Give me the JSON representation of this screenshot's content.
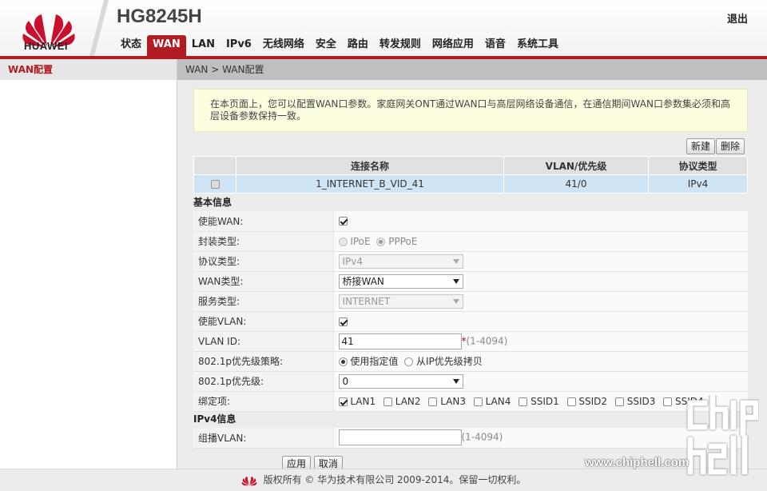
{
  "brand": {
    "logo_text": "HUAWEI",
    "model": "HG8245H",
    "accent_color": "#b11c22"
  },
  "header": {
    "logout_label": "退出"
  },
  "nav": [
    {
      "label": "状态",
      "active": false
    },
    {
      "label": "WAN",
      "active": true
    },
    {
      "label": "LAN",
      "active": false
    },
    {
      "label": "IPv6",
      "active": false
    },
    {
      "label": "无线网络",
      "active": false
    },
    {
      "label": "安全",
      "active": false
    },
    {
      "label": "路由",
      "active": false
    },
    {
      "label": "转发规则",
      "active": false
    },
    {
      "label": "网络应用",
      "active": false
    },
    {
      "label": "语音",
      "active": false
    },
    {
      "label": "系统工具",
      "active": false
    }
  ],
  "sidebar": {
    "items": [
      {
        "label": "WAN配置",
        "selected": true
      }
    ]
  },
  "breadcrumb": "WAN > WAN配置",
  "notice": "在本页面上，您可以配置WAN口参数。家庭网关ONT通过WAN口与高层网络设备通信，在通信期间WAN口参数集必须和高层设备参数保持一致。",
  "toolbar": {
    "new_label": "新建",
    "delete_label": "删除"
  },
  "wan_table": {
    "headers": [
      "",
      "连接名称",
      "VLAN/优先级",
      "协议类型"
    ],
    "rows": [
      {
        "checked": false,
        "name": "1_INTERNET_B_VID_41",
        "vlan_priority": "41/0",
        "protocol": "IPv4"
      }
    ]
  },
  "basic": {
    "title": "基本信息",
    "enable_wan": {
      "label": "使能WAN:",
      "checked": true
    },
    "encap": {
      "label": "封装类型:",
      "options": [
        "IPoE",
        "PPPoE"
      ],
      "selected": "PPPoE"
    },
    "protocol": {
      "label": "协议类型:",
      "value": "IPv4"
    },
    "wan_type": {
      "label": "WAN类型:",
      "value": "桥接WAN"
    },
    "service_type": {
      "label": "服务类型:",
      "value": "INTERNET"
    },
    "enable_vlan": {
      "label": "使能VLAN:",
      "checked": true
    },
    "vlan_id": {
      "label": "VLAN ID:",
      "value": "41",
      "required_mark": "*",
      "hint": "(1-4094)"
    },
    "priority_policy": {
      "label": "802.1p优先级策略:",
      "options": [
        "使用指定值",
        "从IP优先级拷贝"
      ],
      "selected": "使用指定值"
    },
    "priority": {
      "label": "802.1p优先级:",
      "value": "0"
    },
    "binding": {
      "label": "绑定项:",
      "items": [
        {
          "label": "LAN1",
          "checked": true
        },
        {
          "label": "LAN2",
          "checked": false
        },
        {
          "label": "LAN3",
          "checked": false
        },
        {
          "label": "LAN4",
          "checked": false
        },
        {
          "label": "SSID1",
          "checked": false
        },
        {
          "label": "SSID2",
          "checked": false
        },
        {
          "label": "SSID3",
          "checked": false
        },
        {
          "label": "SSID4",
          "checked": false
        }
      ]
    }
  },
  "ipv4": {
    "title": "IPv4信息",
    "multicast_vlan": {
      "label": "组播VLAN:",
      "value": "",
      "hint": "(1-4094)"
    }
  },
  "actions": {
    "apply_label": "应用",
    "cancel_label": "取消"
  },
  "footer": {
    "text": "版权所有 © 华为技术有限公司 2009-2014。保留一切权利。"
  },
  "watermark": {
    "text": "www.chiphell.com"
  }
}
